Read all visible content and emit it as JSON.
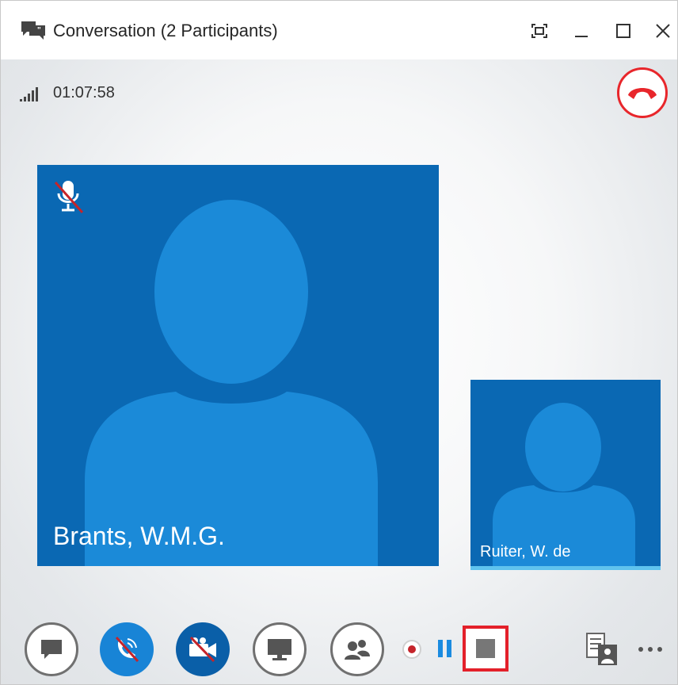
{
  "window": {
    "title": "Conversation (2 Participants)"
  },
  "status": {
    "duration": "01:07:58"
  },
  "participants": [
    {
      "name": "Brants, W.M.G.",
      "muted": true,
      "speaking": false
    },
    {
      "name": "Ruiter, W. de",
      "muted": false,
      "speaking": true
    }
  ],
  "toolbar": {
    "buttons": [
      "im-icon",
      "audio-muted-icon",
      "video-off-icon",
      "present-icon",
      "participants-icon"
    ]
  },
  "recording": {
    "state": "recording"
  },
  "colors": {
    "tile_blue": "#0a68b3",
    "avatar_blue": "#1b8ad8",
    "hangup_red": "#e8262b",
    "highlight_red": "#e3202a",
    "speaking_bar": "#5fc3ee"
  }
}
